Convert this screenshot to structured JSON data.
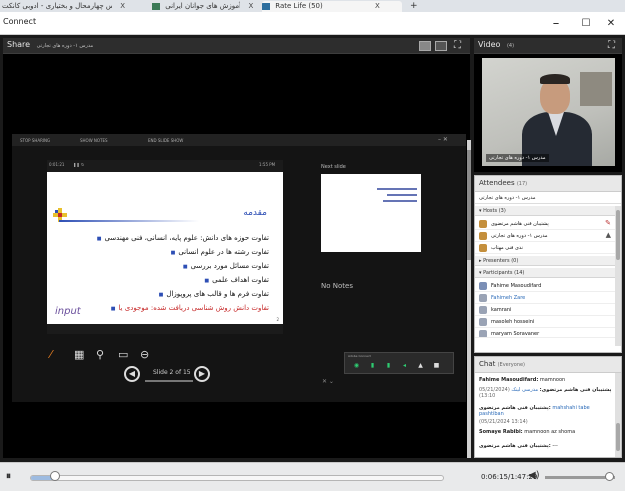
{
  "browser": {
    "tabs": [
      {
        "label": "مدرس چهارمحال و بختیاری - ادوبی کانکت",
        "close": "X"
      },
      {
        "label": "آموزش های جوانان ایرانی",
        "close": "X"
      },
      {
        "label": "Rate Life (50)",
        "close": "X"
      }
    ],
    "new_tab": "+"
  },
  "window": {
    "title": "Connect",
    "minimize": "–",
    "maximize": "☐",
    "close": "✕"
  },
  "share_pod": {
    "title": "Share",
    "subtitle": "مدرس ۱- دوره های تجارتی"
  },
  "presenter": {
    "toolbar": [
      "STOP SHARING",
      "SHOW NOTES",
      "END SLIDE SHOW"
    ],
    "elapsed": "0:01:21",
    "clock": "1:55 PM",
    "slide": {
      "title": "مقدمه",
      "bullets": [
        "تفاوت حوزه های دانش: علوم پایه، انسانی، فنی مهندسی",
        "تفاوت رشته ها در علوم انسانی",
        "تفاوت مسائل مورد بررسی",
        "تفاوت اهداف علمی",
        "تفاوت فرم ها و قالب های پروپوزال",
        "تفاوت دانش روش شناسی دریافت شده: موجودی یا"
      ],
      "ink_text": "input",
      "page_num": "2"
    },
    "slide_counter": "Slide 2 of 15",
    "next_slide_label": "Next slide",
    "notes": "No Notes",
    "mini_panel_title": "Adobe Connect"
  },
  "video_pod": {
    "title": "Video",
    "count": "(4)",
    "caption": "مدرس ۱- دوره های تجارتی"
  },
  "attendees": {
    "title": "Attendees",
    "count": "(17)",
    "status": "مدرس ۱- دوره های تجارتی",
    "hosts": {
      "label": "Hosts (3)",
      "people": [
        "پشتیبان فنی هاشم مرتضوی",
        "مدرس ۱- دوره های تجارتی",
        "ندی فنی مهتاب"
      ]
    },
    "presenters": {
      "label": "Presenters (0)"
    },
    "participants": {
      "label": "Participants (14)",
      "people": [
        "Fahime Masoudifard",
        "Fahimeh Zare",
        "kamrani",
        "masoleh hosseini",
        "maryam Soravaner"
      ]
    }
  },
  "chat": {
    "title": "Chat",
    "scope": "(Everyone)",
    "messages": [
      {
        "sender": "Fahime Masoudifard:",
        "text": "mamnoon"
      },
      {
        "sender": "پشتیبان فنی هاشم مرتضوی:",
        "text": "مدرسی لینک",
        "time": "(05/21/2024 13:10)"
      },
      {
        "sender": "پشتیبان فنی هاشم مرتضوی:",
        "text": "mahshahi tabe pashtiban"
      },
      {
        "sender": "",
        "text": "",
        "time": "(05/21/2024 13:14)"
      },
      {
        "sender": "Somaye Rabibi:",
        "text": "mamnoon az shoma"
      },
      {
        "sender": "پشتیبان فنی هاشم مرتضوی:",
        "text": "---"
      }
    ]
  },
  "playback": {
    "play_icon": "⏸",
    "progress": 0.06,
    "elapsed": "0:06:15",
    "total": "1:47:29",
    "volume_icon": "◀)",
    "volume": 0.92
  }
}
